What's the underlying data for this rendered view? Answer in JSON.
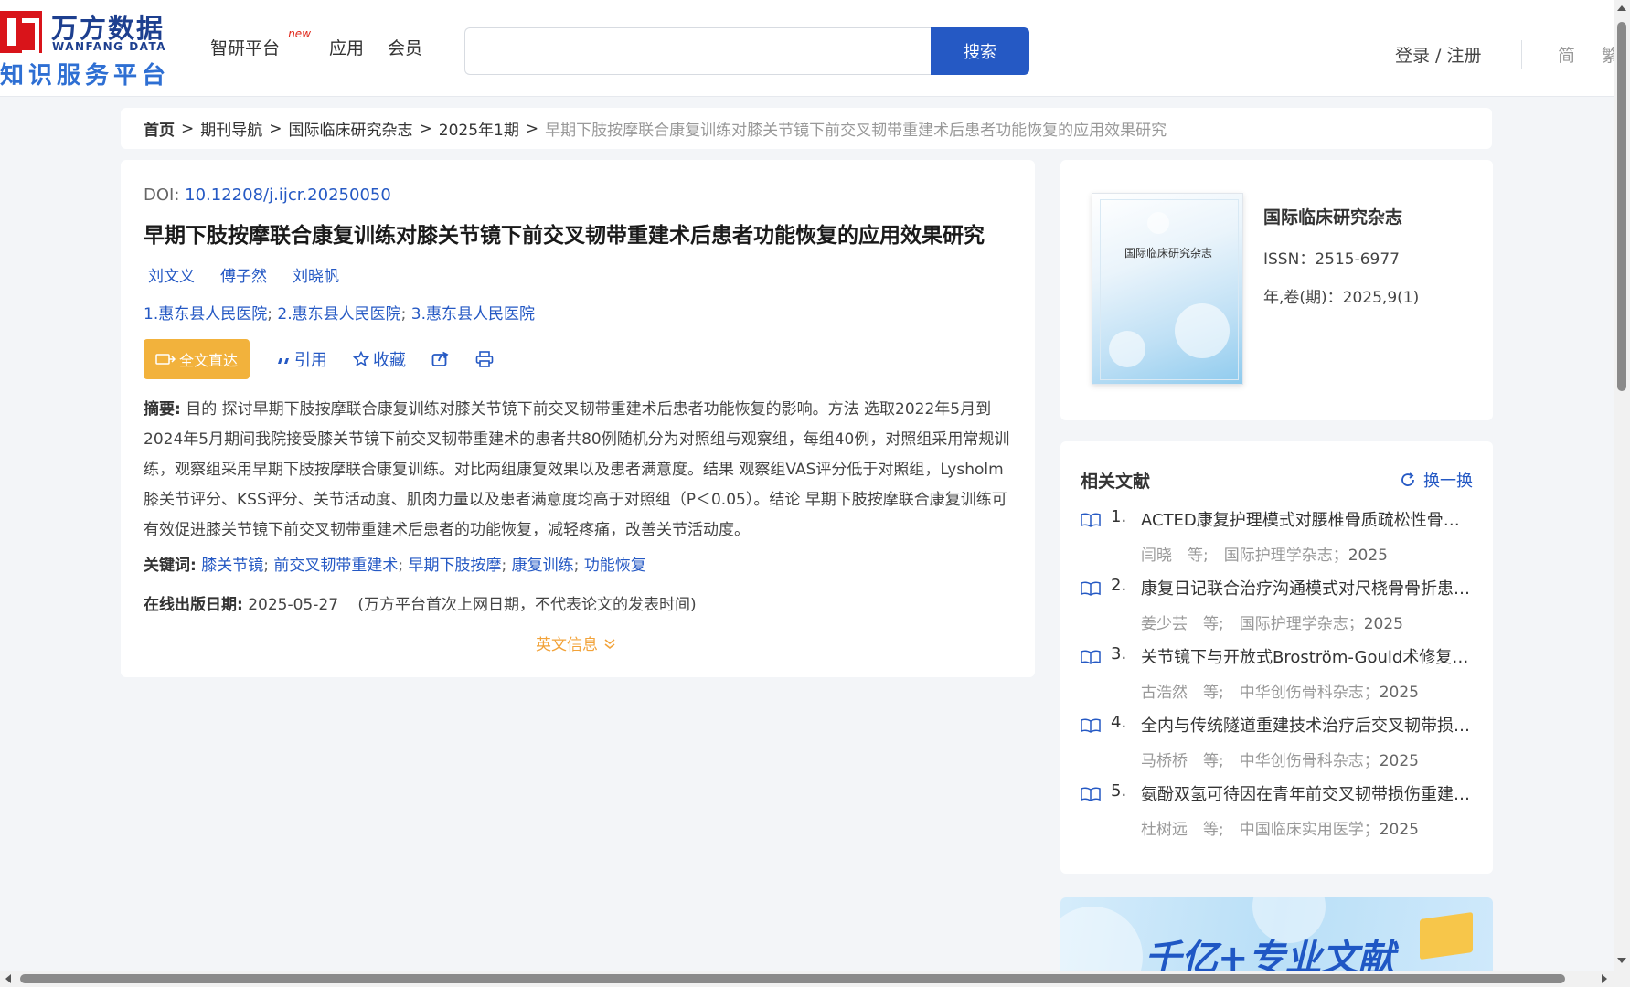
{
  "header": {
    "logo_cn": "万方数据",
    "logo_en": "WANFANG DATA",
    "logo_sub": "知识服务平台",
    "nav": [
      {
        "label": "智研平台",
        "badge": "new"
      },
      {
        "label": "应用"
      },
      {
        "label": "会员"
      }
    ],
    "search_value": "",
    "search_button": "搜索",
    "login": "登录 / 注册",
    "lang_simplified": "简",
    "lang_traditional": "繁"
  },
  "breadcrumb": {
    "home": "首页",
    "items": [
      "期刊导航",
      "国际临床研究杂志",
      "2025年1期"
    ],
    "sep": ">",
    "current": "早期下肢按摩联合康复训练对膝关节镜下前交叉韧带重建术后患者功能恢复的应用效果研究"
  },
  "article": {
    "doi_label": "DOI:",
    "doi": "10.12208/j.ijcr.20250050",
    "title": "早期下肢按摩联合康复训练对膝关节镜下前交叉韧带重建术后患者功能恢复的应用效果研究",
    "authors": [
      "刘文义",
      "傅子然",
      "刘晓帆"
    ],
    "affiliations": [
      "1.惠东县人民医院",
      "2.惠东县人民医院",
      "3.惠东县人民医院"
    ],
    "affil_sep": ";",
    "actions": {
      "fulltext": "全文直达",
      "cite": "引用",
      "favorite": "收藏"
    },
    "abstract_label": "摘要:",
    "abstract": "目的 探讨早期下肢按摩联合康复训练对膝关节镜下前交叉韧带重建术后患者功能恢复的影响。方法 选取2022年5月到2024年5月期间我院接受膝关节镜下前交叉韧带重建术的患者共80例随机分为对照组与观察组，每组40例，对照组采用常规训练，观察组采用早期下肢按摩联合康复训练。对比两组康复效果以及患者满意度。结果 观察组VAS评分低于对照组，Lysholm膝关节评分、KSS评分、关节活动度、肌肉力量以及患者满意度均高于对照组（P＜0.05）。结论 早期下肢按摩联合康复训练可有效促进膝关节镜下前交叉韧带重建术后患者的功能恢复，减轻疼痛，改善关节活动度。",
    "keywords_label": "关键词:",
    "keywords": [
      "膝关节镜",
      "前交叉韧带重建术",
      "早期下肢按摩",
      "康复训练",
      "功能恢复"
    ],
    "kw_sep": ";",
    "online_label": "在线出版日期:",
    "online_date": "2025-05-27",
    "online_note": "(万方平台首次上网日期，不代表论文的发表时间)",
    "english_info": "英文信息"
  },
  "journal": {
    "cover_title": "国际临床研究杂志",
    "name": "国际临床研究杂志",
    "issn": "ISSN：2515-6977",
    "volume": "年,卷(期)：2025,9(1)"
  },
  "related": {
    "title": "相关文献",
    "refresh": "换一换",
    "items": [
      {
        "num": "1.",
        "title": "ACTED康复护理模式对腰椎骨质疏松性骨折患者的影响",
        "meta": "闫晓　等;　国际护理学杂志；",
        "year": "2025"
      },
      {
        "num": "2.",
        "title": "康复日记联合治疗沟通模式对尺桡骨骨折患者的影响",
        "meta": "姜少芸　等;　国际护理学杂志；",
        "year": "2025"
      },
      {
        "num": "3.",
        "title": "关节镜下与开放式Broström-Gould术修复踝关节外侧韧带",
        "meta": "古浩然　等;　中华创伤骨科杂志；",
        "year": "2025"
      },
      {
        "num": "4.",
        "title": "全内与传统隧道重建技术治疗后交叉韧带损伤的疗效",
        "meta": "马桥桥　等;　中华创伤骨科杂志；",
        "year": "2025"
      },
      {
        "num": "5.",
        "title": "氨酚双氢可待因在青年前交叉韧带损伤重建术后的镇痛效果",
        "meta": "杜树远　等;　中国临床实用医学；",
        "year": "2025"
      }
    ]
  },
  "banner": {
    "text": "千亿+专业文献"
  },
  "colors": {
    "brand_blue": "#2559c4",
    "accent_orange": "#f2b23c",
    "logo_red": "#d9141a"
  }
}
